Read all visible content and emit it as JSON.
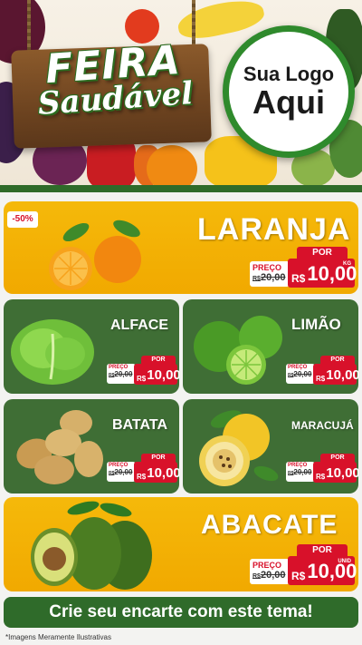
{
  "header": {
    "title_line1": "FEIRA",
    "title_line2": "Saudável",
    "logo_line1": "Sua Logo",
    "logo_line2": "Aqui"
  },
  "colors": {
    "brand_green": "#2f6b2a",
    "card_yellow": "#f3b102",
    "card_green": "#3f6e35",
    "price_red": "#d8112a"
  },
  "discount_badge": "-50%",
  "products": {
    "laranja": {
      "name": "LARANJA",
      "preco_label": "PREÇO",
      "old_prefix": "R$",
      "old_price": "20,00",
      "por_label": "POR",
      "currency": "R$",
      "price": "10,00",
      "unit": "KG"
    },
    "alface": {
      "name": "ALFACE",
      "preco_label": "PREÇO",
      "old_prefix": "R$",
      "old_price": "20,00",
      "por_label": "POR",
      "currency": "R$",
      "price": "10,00"
    },
    "limao": {
      "name": "LIMÃO",
      "preco_label": "PREÇO",
      "old_prefix": "R$",
      "old_price": "20,00",
      "por_label": "POR",
      "currency": "R$",
      "price": "10,00"
    },
    "batata": {
      "name": "BATATA",
      "preco_label": "PREÇO",
      "old_prefix": "R$",
      "old_price": "20,00",
      "por_label": "POR",
      "currency": "R$",
      "price": "10,00"
    },
    "maracuja": {
      "name": "MARACUJÁ",
      "preco_label": "PREÇO",
      "old_prefix": "R$",
      "old_price": "20,00",
      "por_label": "POR",
      "currency": "R$",
      "price": "10,00"
    },
    "abacate": {
      "name": "ABACATE",
      "preco_label": "PREÇO",
      "old_prefix": "R$",
      "old_price": "20,00",
      "por_label": "POR",
      "currency": "R$",
      "price": "10,00",
      "unit": "UNID"
    }
  },
  "cta": "Crie seu encarte com este tema!",
  "disclaimer": "*Imagens Meramente Ilustrativas"
}
